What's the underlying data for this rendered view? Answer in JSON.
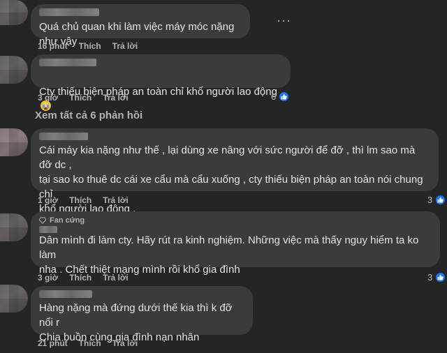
{
  "comments": [
    {
      "text": "Quá chủ quan khi làm việc máy móc nặng như vậy",
      "time": "16 phút",
      "like": "Thích",
      "reply": "Trả lời"
    },
    {
      "text": "Cty thiếu biện pháp an toàn chỉ khổ người lao động",
      "time": "3 giờ",
      "like": "Thích",
      "reply": "Trả lời",
      "reaction_count": "6"
    },
    {
      "text": "Cái máy kia nặng như thế , lại dùng xe nâng với sức người để đỡ , thì lm sao mà đỡ dc ,\ntại sao ko thuê dc cái xe cẩu mà cẩu xuống , cty thiếu biện pháp an toàn nói chung chỉ\nkhổ người lao động ,",
      "time": "1 giờ",
      "like": "Thích",
      "reply": "Trả lời",
      "reaction_count": "3"
    },
    {
      "badge": "Fan cứng",
      "text": "Dân mình đi làm cty. Hãy rút ra kinh nghiệm. Những việc mà thấy nguy hiểm ta ko làm\nnha . Chết thiệt mạng mình rồi khổ gia đình",
      "time": "3 giờ",
      "like": "Thích",
      "reply": "Trả lời",
      "reaction_count": "3"
    },
    {
      "text": "Hàng nặng mà đứng dưới thế kia thì k đỡ nổi r\nChia buồn cùng gia đình nạn nhân",
      "time": "21 phút",
      "like": "Thích",
      "reply": "Trả lời"
    }
  ],
  "view_all_replies": "Xem tất cả 6 phản hồi",
  "more_label": "···",
  "icons": {
    "like": "like-thumb-icon",
    "more": "more-horizontal-icon",
    "emoji": "crying-face-emoji",
    "fan_badge": "diamond-icon"
  },
  "colors": {
    "background": "#242526",
    "bubble": "#3a3b3c",
    "text": "#e4e6eb",
    "secondary": "#b0b3b8",
    "like_blue": "#1877f2"
  }
}
